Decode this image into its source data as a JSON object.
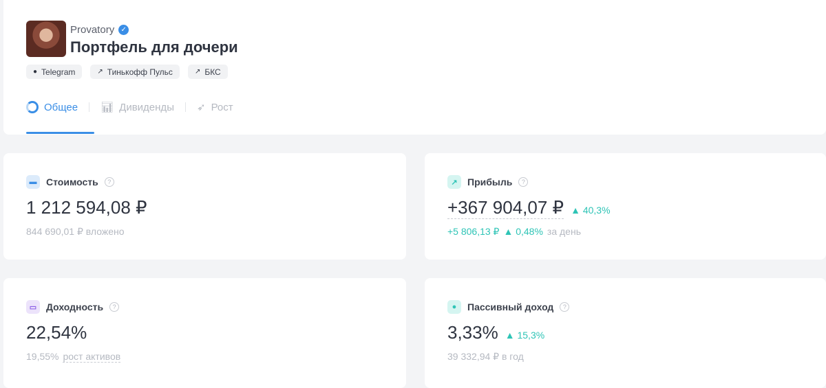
{
  "header": {
    "author": "Provatory",
    "title": "Портфель для дочери",
    "links": [
      {
        "label": "Telegram",
        "icon": "telegram-icon"
      },
      {
        "label": "Тинькофф Пульс",
        "icon": "external-link-icon"
      },
      {
        "label": "БКС",
        "icon": "external-link-icon"
      }
    ],
    "tabs": [
      {
        "label": "Общее",
        "active": true
      },
      {
        "label": "Дивиденды"
      },
      {
        "label": "Рост"
      }
    ]
  },
  "cards": {
    "value": {
      "label": "Стоимость",
      "amount": "1 212 594,08 ₽",
      "invested": "844 690,01 ₽ вложено"
    },
    "profit": {
      "label": "Прибыль",
      "amount": "+367 904,07 ₽",
      "pct": "40,3%",
      "day_amount": "+5 806,13 ₽",
      "day_pct": "0,48%",
      "day_suffix": "за день"
    },
    "yield": {
      "label": "Доходность",
      "amount": "22,54%",
      "growth": "19,55%",
      "growth_label": "рост активов"
    },
    "passive": {
      "label": "Пассивный доход",
      "amount": "3,33%",
      "pct": "15,3%",
      "per_year": "39 332,94 ₽ в год"
    }
  },
  "colors": {
    "accent": "#3a8ee6",
    "positive": "#2ec4b6"
  }
}
